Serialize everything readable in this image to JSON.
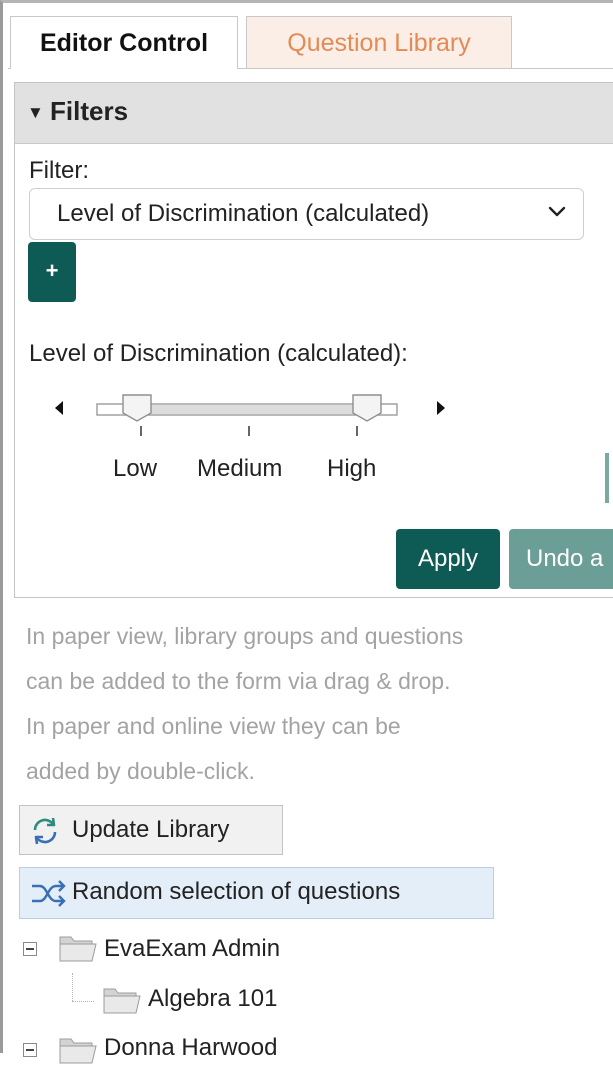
{
  "tabs": [
    {
      "label": "Editor Control",
      "active": true
    },
    {
      "label": "Question Library",
      "active": false
    }
  ],
  "filters": {
    "title": "Filters",
    "filter_label": "Filter:",
    "selected_filter": "Level of Discrimination (calculated)",
    "add_label": "+",
    "slider_label": "Level of Discrimination (calculated):",
    "slider_ticks": [
      "Low",
      "Medium",
      "High"
    ],
    "slider_range": {
      "low": "Low",
      "high": "High"
    },
    "apply_label": "Apply",
    "undo_label": "Undo a"
  },
  "info": [
    "In paper view, library groups and questions",
    "can be added to the form via drag & drop.",
    "In paper and online view they can be",
    "added by double-click."
  ],
  "buttons": {
    "update_library": "Update Library",
    "random_selection": "Random selection of questions"
  },
  "tree": {
    "groups": [
      {
        "name": "EvaExam Admin",
        "children": [
          "Algebra 101"
        ]
      },
      {
        "name": "Donna Harwood",
        "children": []
      }
    ]
  },
  "colors": {
    "primary": "#0e5b55",
    "secondary": "#6b9e97",
    "inactive_tab_text": "#e28b57",
    "inactive_tab_bg": "#fbeee6",
    "info_text": "#a3a3a3"
  }
}
